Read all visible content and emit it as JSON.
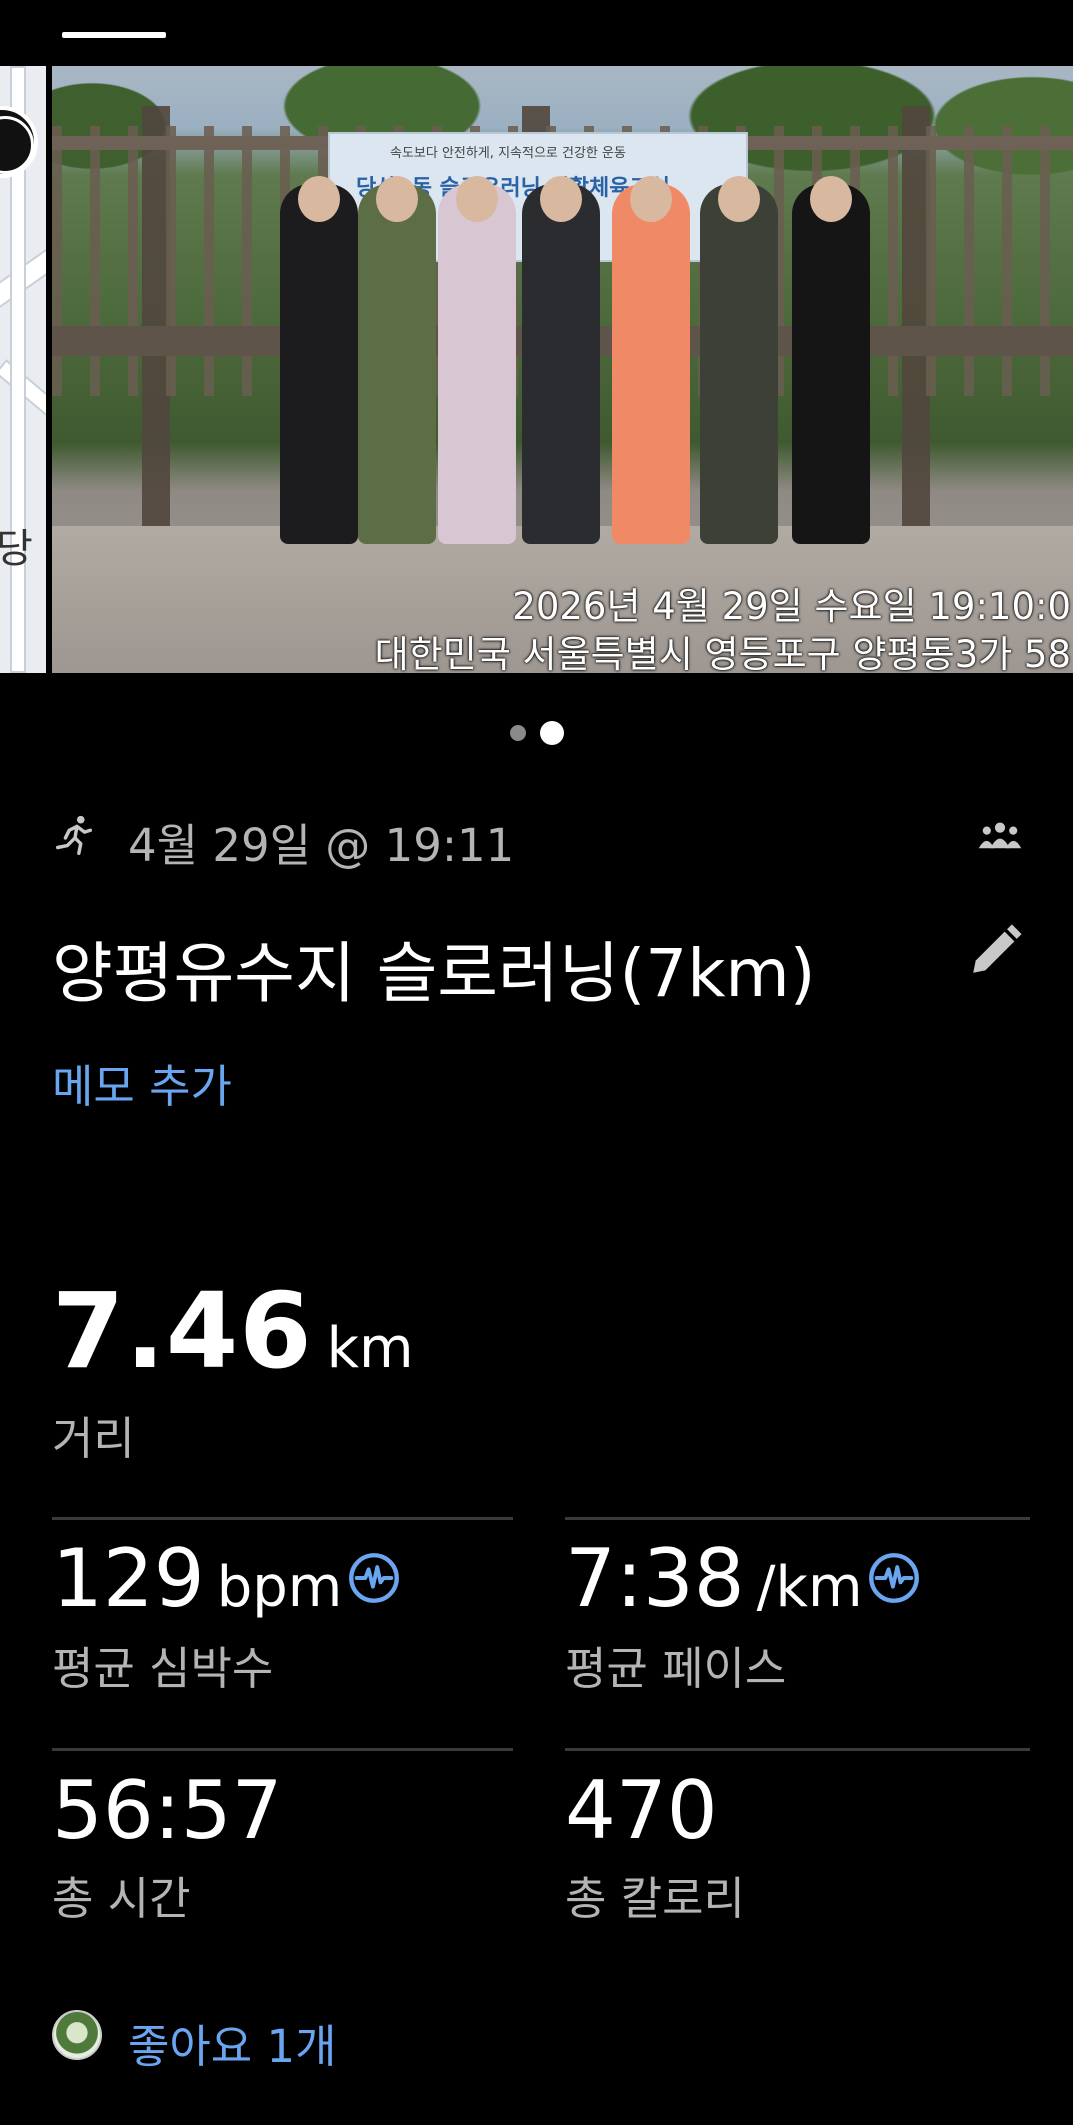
{
  "photo": {
    "banner_line1": "속도보다 안전하게, 지속적으로 건강한 운동",
    "banner_line2": "당산1동 슬로우러닝 생활체육교실",
    "map_label": "당",
    "timestamp": "2026년 4월 29일 수요일 19:10:0",
    "location": "대한민국 서울특별시 영등포구 양평동3가 58"
  },
  "carousel": {
    "total_pages": 2,
    "current_page": 2
  },
  "activity": {
    "date_time": "4월 29일 @ 19:11",
    "title": "양평유수지 슬로러닝(7km)",
    "add_memo": "메모 추가",
    "type_icon": "running-icon",
    "group_icon": "group-icon"
  },
  "distance": {
    "value": "7.46",
    "unit": "km",
    "label": "거리"
  },
  "stats": {
    "heart_rate": {
      "value": "129",
      "unit": "bpm",
      "label": "평균 심박수"
    },
    "pace": {
      "value": "7:38",
      "unit": "/km",
      "label": "평균 페이스"
    },
    "duration": {
      "value": "56:57",
      "label": "총 시간"
    },
    "calories": {
      "value": "470",
      "label": "총 칼로리"
    }
  },
  "likes": {
    "text": "좋아요 1개"
  },
  "colors": {
    "background": "#000000",
    "accent": "#6aa6f0",
    "secondary_text": "#b4b4b4"
  }
}
